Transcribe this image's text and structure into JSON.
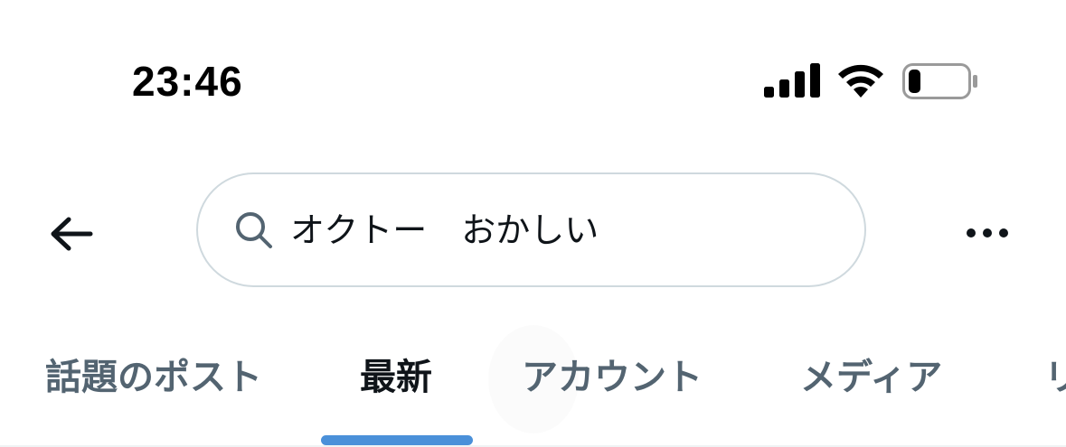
{
  "status_bar": {
    "time": "23:46",
    "icons": [
      "signal-icon",
      "wifi-icon",
      "battery-icon"
    ],
    "battery_level": 0.2
  },
  "header": {
    "back_icon": "arrow-left-icon",
    "search": {
      "icon": "search-icon",
      "value": "オクトー　おかしい"
    },
    "more_icon": "more-horizontal-icon"
  },
  "tabs": {
    "items": [
      {
        "label": "話題のポスト",
        "active": false
      },
      {
        "label": "最新",
        "active": true
      },
      {
        "label": "アカウント",
        "active": false
      },
      {
        "label": "メディア",
        "active": false
      },
      {
        "label": "リ",
        "active": false
      }
    ],
    "indicator_color": "#4a90d9"
  },
  "colors": {
    "text_primary": "#0f1419",
    "text_secondary": "#536471",
    "border": "#cfd9de"
  }
}
